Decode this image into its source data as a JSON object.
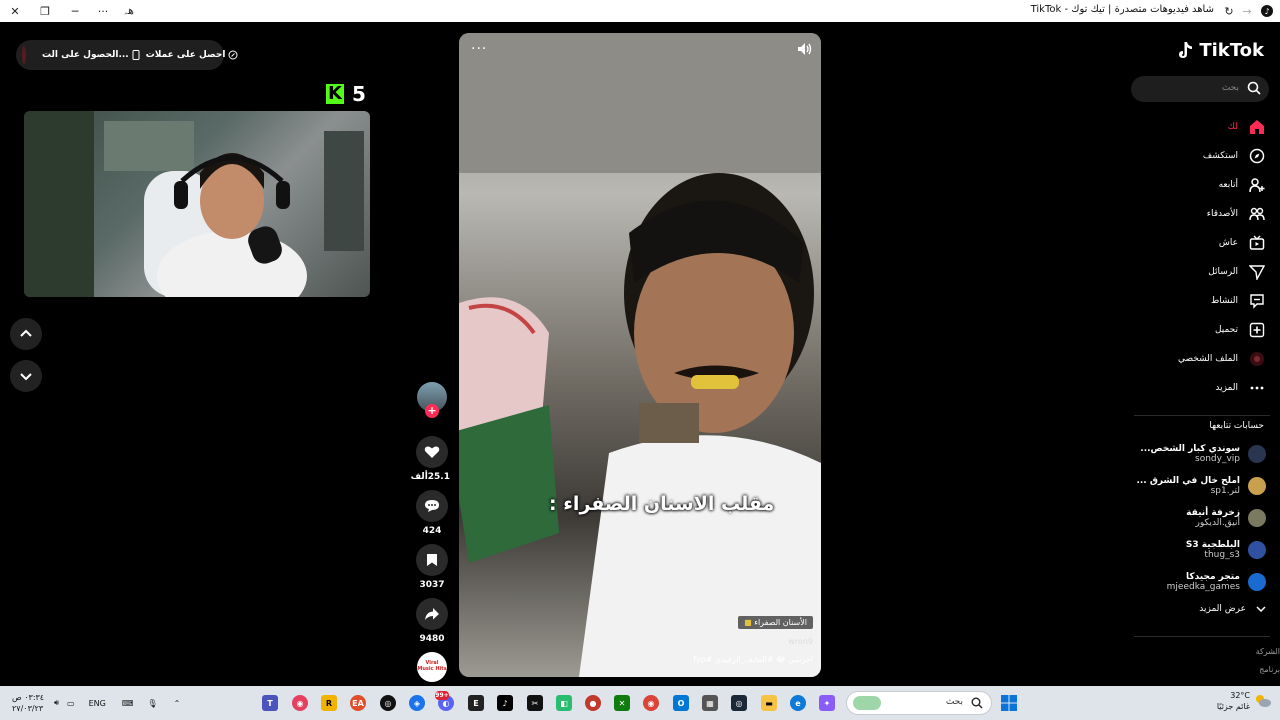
{
  "browser": {
    "title": "شاهد فيديوهات متصدرة | تيك توك - TikTok",
    "menu_dots": "···",
    "translate_label": "ﮬﮧ"
  },
  "promo": {
    "coins_label": "احصل على عملات",
    "app_label": "الحصول على الت..."
  },
  "kick": {
    "logo_letter": "K",
    "viewer_count": "5"
  },
  "video": {
    "caption": "مقلب الاسنان الصفراء :",
    "sticker_label": "الأسنان الصفراء",
    "watermark": "wron9",
    "description": "احرشي 😂 #المايف_الرفيدي #fyp"
  },
  "actions": {
    "likes": "25.1ألف",
    "comments": "424",
    "saves": "3037",
    "shares": "9480",
    "music_label": "Viral Music Hits"
  },
  "sidebar": {
    "logo": "TikTok",
    "search_placeholder": "بحث",
    "menu": [
      {
        "label": "لك",
        "icon": "home-icon",
        "active": true
      },
      {
        "label": "استكشف",
        "icon": "compass-icon"
      },
      {
        "label": "أتابعه",
        "icon": "user-plus-icon"
      },
      {
        "label": "الأصدقاء",
        "icon": "friends-icon"
      },
      {
        "label": "عاش",
        "icon": "live-icon"
      },
      {
        "label": "الرسائل",
        "icon": "send-icon"
      },
      {
        "label": "النشاط",
        "icon": "message-icon"
      },
      {
        "label": "تحميل",
        "icon": "upload-icon"
      },
      {
        "label": "الملف الشخصي",
        "icon": "profile-avatar-icon"
      },
      {
        "label": "المزيد",
        "icon": "more-icon"
      }
    ],
    "following_title": "حسابات تتابعها",
    "following": [
      {
        "name": "سوندي كبار الشخص...",
        "handle": "sondy_vip",
        "color": "#2a3550"
      },
      {
        "name": "املح خال في الشرق ...",
        "handle": "sp1.لتر",
        "color": "#c8a050"
      },
      {
        "name": "زخرفة أنيقة",
        "handle": "أنيق.الديكور",
        "color": "#7a7a60"
      },
      {
        "name": "البلطجية S3",
        "handle": "thug_s3",
        "color": "#3050a0"
      },
      {
        "name": "متجر مجيدكا",
        "handle": "mjeedka_games",
        "color": "#1a6ad0"
      }
    ],
    "see_more": "عرض المزيد",
    "footer": [
      "الشركة",
      "برنامج"
    ]
  },
  "taskbar": {
    "search_placeholder": "بحث",
    "language": "ENG",
    "time": "٠٣:٣٤ ص",
    "date": "٢٧/٠٣/٢٣",
    "temperature": "32°C",
    "weather": "غائم جزئيًا",
    "badge": "99+"
  }
}
